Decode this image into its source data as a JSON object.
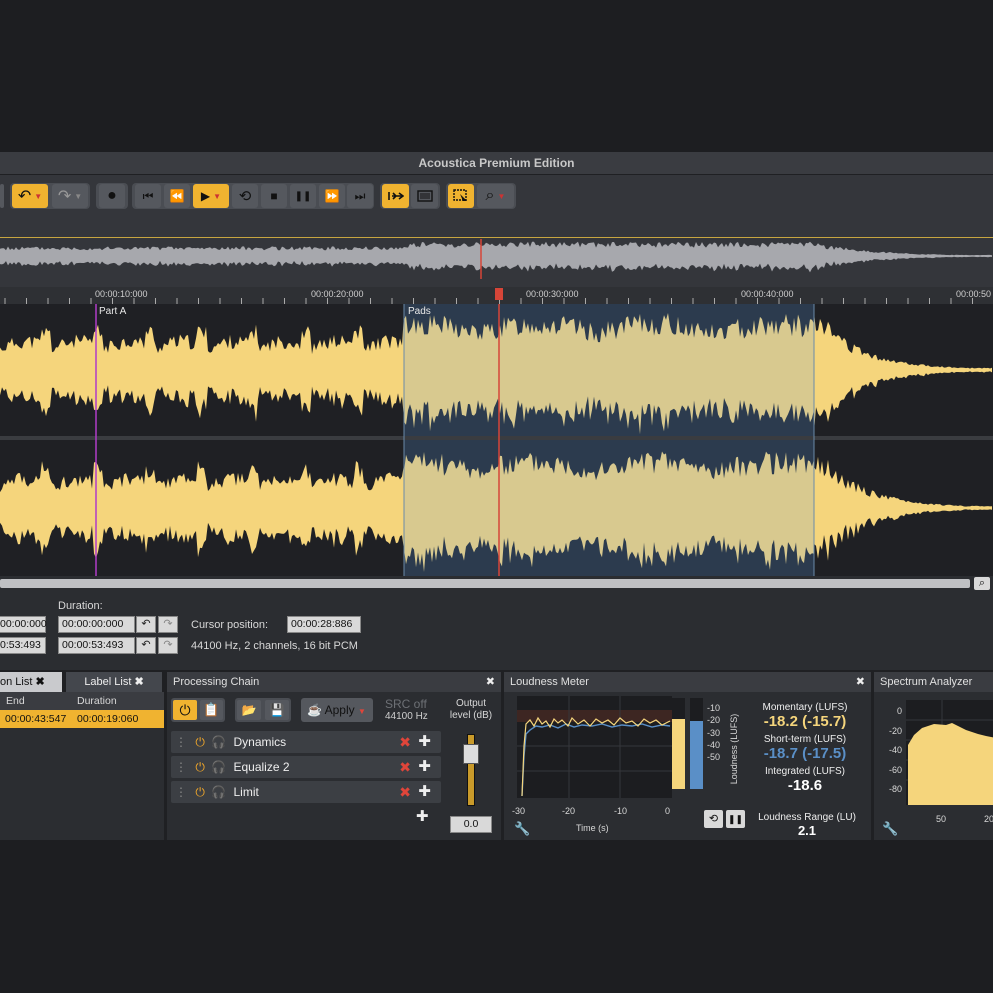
{
  "window": {
    "title": "Acoustica Premium Edition"
  },
  "toolbar": {
    "undo": "↶",
    "redo": "↷",
    "record": "●",
    "transport": [
      "⏮",
      "⏪",
      "▶",
      "⟲",
      "■",
      "❚❚",
      "⏩",
      "⏭"
    ],
    "zoom_icon": "⌕"
  },
  "ruler": {
    "ticks": [
      "00:00:10:000",
      "00:00:20:000",
      "00:00:30:000",
      "00:00:40:000",
      "00:00:50"
    ]
  },
  "regions": {
    "part_a": "Part A",
    "pads": "Pads"
  },
  "info": {
    "duration_label": "Duration:",
    "start_value": "00:00:000",
    "duration_value_1": "00:00:00:000",
    "end_value": "0:53:493",
    "duration_value_2": "00:00:53:493",
    "cursor_label": "Cursor position:",
    "cursor_value": "00:00:28:886",
    "format_text": "44100 Hz, 2 channels, 16 bit PCM"
  },
  "region_list": {
    "tab_region": "on List",
    "tab_label": "Label List",
    "col_end": "End",
    "col_duration": "Duration",
    "row_end": "00:00:43:547",
    "row_duration": "00:00:19:060"
  },
  "processing_chain": {
    "title": "Processing Chain",
    "apply_label": "Apply",
    "src_label": "SRC off",
    "src_rate": "44100 Hz",
    "output_label_1": "Output",
    "output_label_2": "level (dB)",
    "output_value": "0.0",
    "effects": [
      "Dynamics",
      "Equalize 2",
      "Limit"
    ]
  },
  "loudness": {
    "title": "Loudness Meter",
    "x_ticks": [
      "-30",
      "-20",
      "-10",
      "0"
    ],
    "x_label": "Time (s)",
    "y_ticks": [
      "-10",
      "-20",
      "-30",
      "-40",
      "-50"
    ],
    "y_label": "Loudness (LUFS)",
    "momentary_label": "Momentary (LUFS)",
    "momentary_value": "-18.2 (-15.7)",
    "short_label": "Short-term (LUFS)",
    "short_value": "-18.7 (-17.5)",
    "integrated_label": "Integrated (LUFS)",
    "integrated_value": "-18.6",
    "range_label": "Loudness Range (LU)",
    "range_value": "2.1"
  },
  "spectrum": {
    "title": "Spectrum Analyzer",
    "y_ticks": [
      "0",
      "-20",
      "-40",
      "-60",
      "-80"
    ],
    "x_ticks": [
      "50",
      "20"
    ]
  },
  "colors": {
    "accent": "#f0b330",
    "wave": "#f5d57c",
    "selection": "#2c3e50",
    "blue": "#5a8fc7"
  }
}
